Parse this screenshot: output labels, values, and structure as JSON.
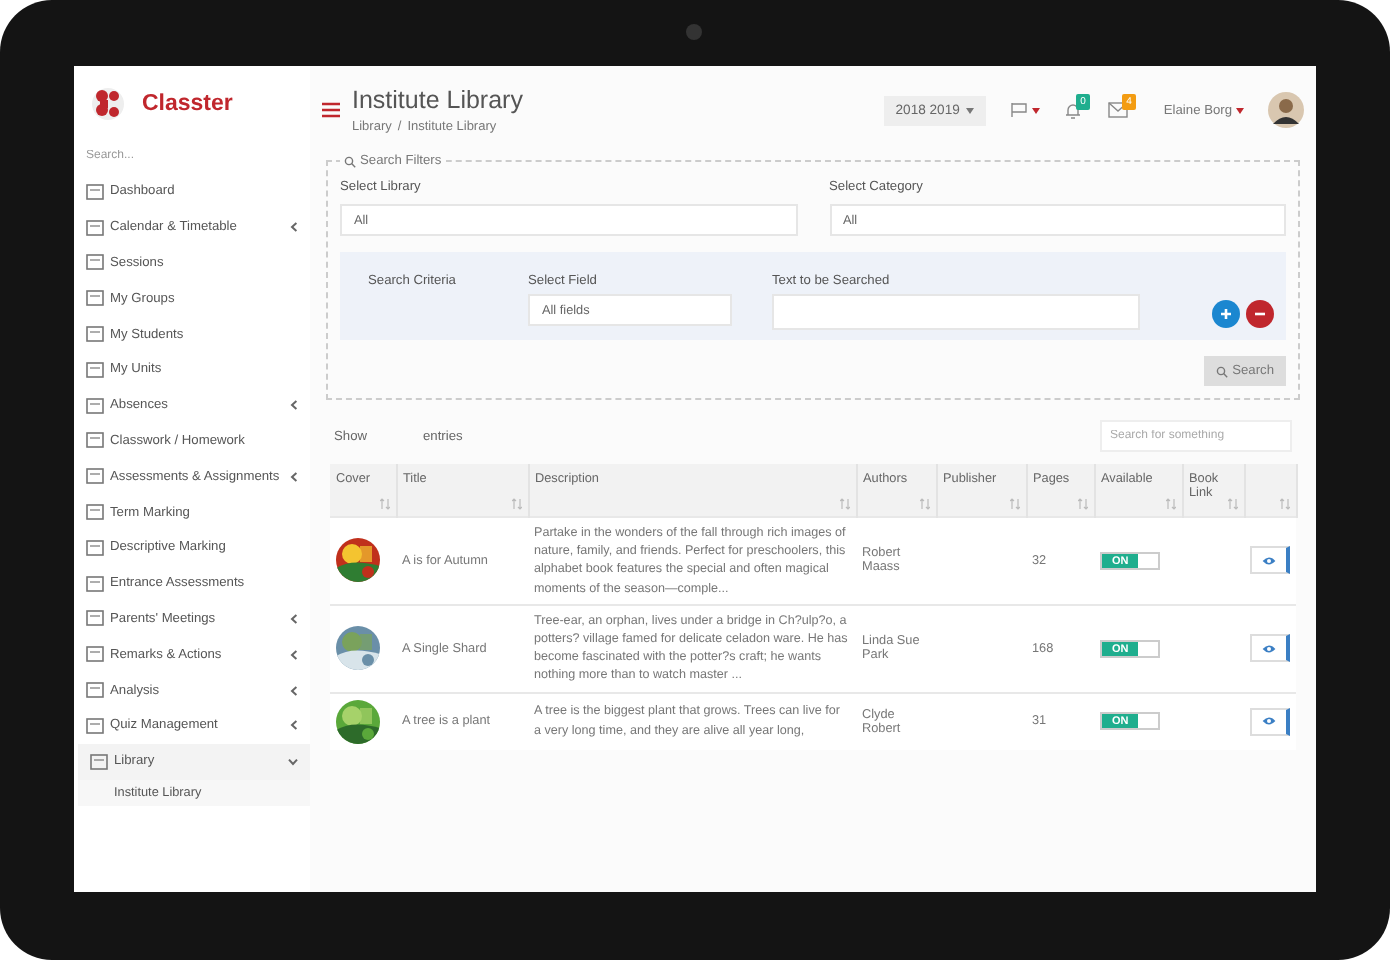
{
  "logo": {
    "text": "Classter"
  },
  "sidebar": {
    "search_placeholder": "Search...",
    "items": [
      {
        "label": "Dashboard",
        "has_submenu": false,
        "selected": false
      },
      {
        "label": "Calendar & Timetable",
        "has_submenu": true,
        "expanded": false,
        "selected": false
      },
      {
        "label": "Sessions",
        "has_submenu": false,
        "selected": false
      },
      {
        "label": "My Groups",
        "has_submenu": false,
        "selected": false
      },
      {
        "label": "My Students",
        "has_submenu": false,
        "selected": false
      },
      {
        "label": "My Units",
        "has_submenu": false,
        "selected": false
      },
      {
        "label": "Absences",
        "has_submenu": true,
        "expanded": false,
        "selected": false
      },
      {
        "label": "Classwork / Homework",
        "has_submenu": false,
        "selected": false
      },
      {
        "label": "Assessments & Assignments",
        "has_submenu": true,
        "expanded": false,
        "selected": false
      },
      {
        "label": "Term Marking",
        "has_submenu": false,
        "selected": false
      },
      {
        "label": "Descriptive Marking",
        "has_submenu": false,
        "selected": false
      },
      {
        "label": "Entrance Assessments",
        "has_submenu": false,
        "selected": false
      },
      {
        "label": "Parents' Meetings",
        "has_submenu": true,
        "expanded": false,
        "selected": false
      },
      {
        "label": "Remarks & Actions",
        "has_submenu": true,
        "expanded": false,
        "selected": false
      },
      {
        "label": "Analysis",
        "has_submenu": true,
        "expanded": false,
        "selected": false
      },
      {
        "label": "Quiz Management",
        "has_submenu": true,
        "expanded": false,
        "selected": false
      },
      {
        "label": "Library",
        "has_submenu": true,
        "expanded": true,
        "selected": true,
        "children": [
          {
            "label": "Institute Library"
          }
        ]
      }
    ]
  },
  "header": {
    "title": "Institute Library",
    "breadcrumb": [
      "Library",
      "Institute Library"
    ],
    "breadcrumb_separator": "/",
    "year": "2018 2019",
    "notifications_badge": "0",
    "messages_badge": "4",
    "user": "Elaine Borg"
  },
  "filters": {
    "legend": "Search Filters",
    "library": {
      "label": "Select Library",
      "value": "All"
    },
    "category": {
      "label": "Select Category",
      "value": "All"
    },
    "criteria": {
      "label": "Search Criteria",
      "field_label": "Select Field",
      "field_value": "All fields",
      "text_label": "Text to be Searched"
    },
    "search_button": "Search"
  },
  "table": {
    "show": "Show",
    "entries": "entries",
    "search_placeholder": "Search for something",
    "columns": [
      "Cover",
      "Title",
      "Description",
      "Authors",
      "Publisher",
      "Pages",
      "Available",
      "Book Link"
    ],
    "rows": [
      {
        "title": "A is for Autumn",
        "description": "Partake in the wonders of the fall through rich images of nature, family, and friends. Perfect for preschoolers, this alphabet book features the special and often magical moments of the season—comple...",
        "authors": "Robert Maass",
        "pages": "32",
        "available": {
          "on": true,
          "label": "ON"
        }
      },
      {
        "title": "A Single Shard",
        "description": "Tree-ear, an orphan, lives under a bridge in Ch?ulp?o, a potters? village famed for delicate celadon ware. He has become fascinated with the potter?s craft; he wants nothing more than to watch master ...",
        "authors": "Linda Sue Park",
        "pages": "168",
        "available": {
          "on": true,
          "label": "ON"
        }
      },
      {
        "title": "A tree is a plant",
        "description": "A tree is the biggest plant that grows. Trees can live for a very long time, and they are alive all year long,",
        "authors": "Clyde Robert",
        "pages": "31",
        "available": {
          "on": true,
          "label": "ON"
        }
      }
    ]
  }
}
